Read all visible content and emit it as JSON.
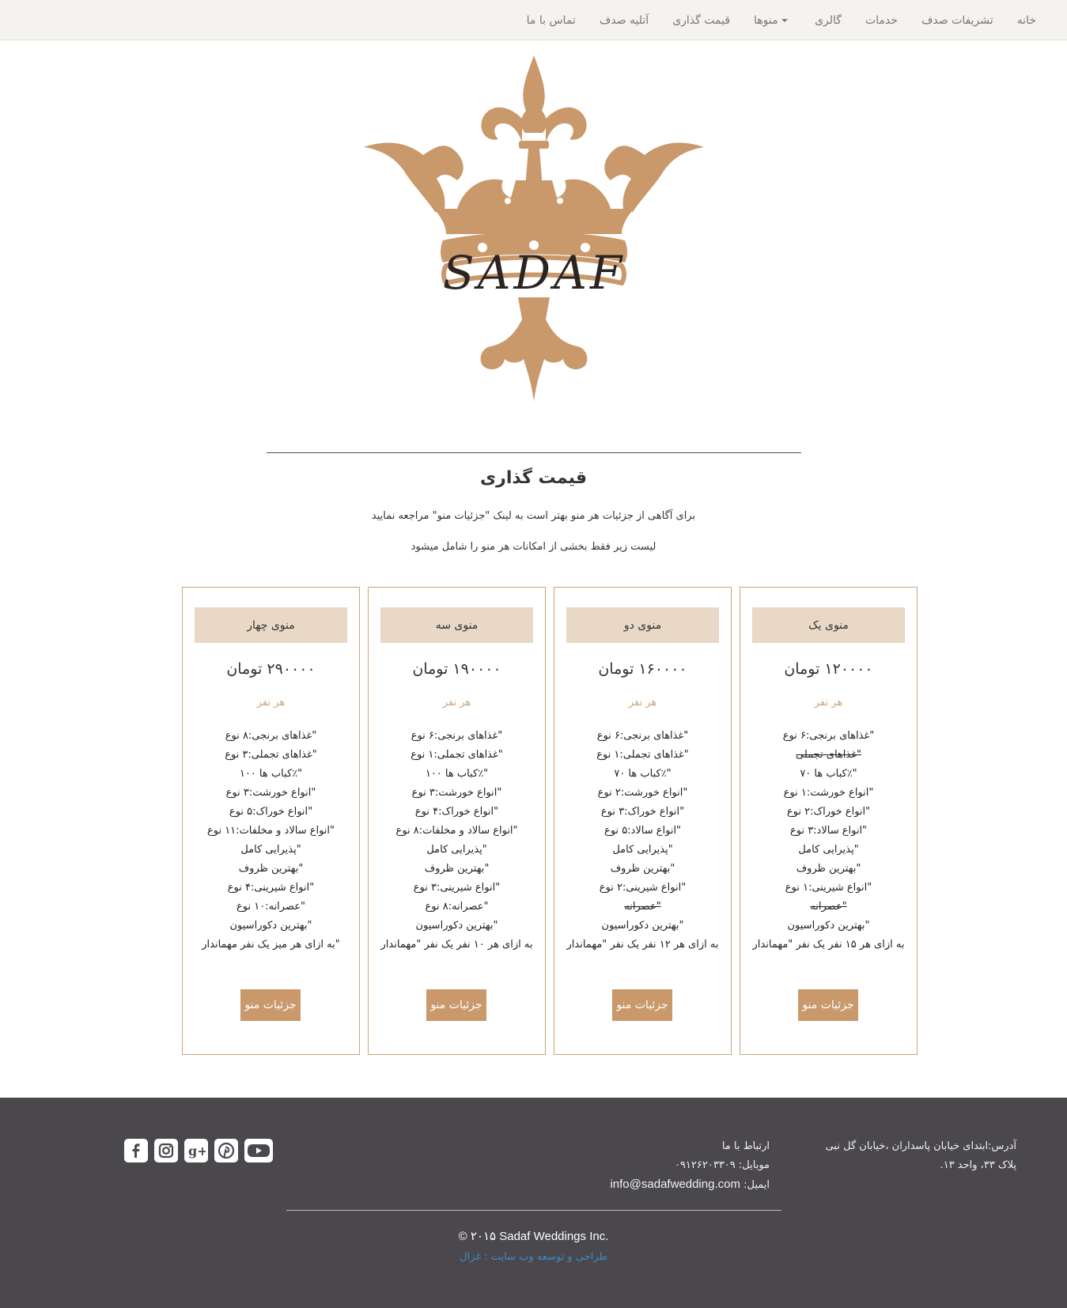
{
  "nav": {
    "items": [
      "خانه",
      "تشریفات صدف",
      "خدمات",
      "گالری",
      "منوها",
      "قیمت گذاری",
      "آتلیه صدف",
      "تماس با ما"
    ]
  },
  "logo": {
    "text": "SADAF"
  },
  "pricing": {
    "title": "قیمت گذاری",
    "intro_1": "برای آگاهی از جزئیات هر منو بهتر است به لینک \"جزئیات منو\" مراجعه نمایید",
    "intro_2": "لیست زیر فقط بخشی از امکانات هر منو را شامل میشود",
    "per_person": "هر نفر",
    "button_label": "جزئیات منو",
    "cards": [
      {
        "title": "منوی یک",
        "price": "۱۲۰۰۰۰ تومان",
        "features": [
          {
            "text": "\"غذاهای برنجی:۶ نوع",
            "struck": false
          },
          {
            "text": "\"غذاهای تجملی",
            "struck": true
          },
          {
            "text": "\"٪کباب ها ۷۰",
            "struck": false
          },
          {
            "text": "\"انواع خورشت:۱ نوع",
            "struck": false
          },
          {
            "text": "\"انواع خوراک:۲ نوع",
            "struck": false
          },
          {
            "text": "\"انواع سالاد:۳ نوع",
            "struck": false
          },
          {
            "text": "\"پذیرایی کامل",
            "struck": false
          },
          {
            "text": "\"بهترین ظروف",
            "struck": false
          },
          {
            "text": "\"انواع شیرینی:۱ نوع",
            "struck": false
          },
          {
            "text": "\"عصرانه",
            "struck": true
          },
          {
            "text": "\"بهترین دکوراسیون",
            "struck": false
          },
          {
            "text": "به ازای هر ۱۵ نفر یک نفر \"مهماندار",
            "struck": false
          }
        ]
      },
      {
        "title": "منوی دو",
        "price": "۱۶۰۰۰۰ تومان",
        "features": [
          {
            "text": "\"غذاهای برنجی:۶ نوع",
            "struck": false
          },
          {
            "text": "\"غذاهای تجملی:۱ نوع",
            "struck": false
          },
          {
            "text": "\"٪کباب ها ۷۰",
            "struck": false
          },
          {
            "text": "\"انواع خورشت:۲ نوع",
            "struck": false
          },
          {
            "text": "\"انواع خوراک:۳ نوع",
            "struck": false
          },
          {
            "text": "\"انواع سالاد:۵ نوع",
            "struck": false
          },
          {
            "text": "\"پذیرایی کامل",
            "struck": false
          },
          {
            "text": "\"بهترین ظروف",
            "struck": false
          },
          {
            "text": "\"انواع شیرینی:۲ نوع",
            "struck": false
          },
          {
            "text": "\"عصرانه",
            "struck": true
          },
          {
            "text": "\"بهترین دکوراسیون",
            "struck": false
          },
          {
            "text": "به ازای هر ۱۲ نفر یک نفر \"مهماندار",
            "struck": false
          }
        ]
      },
      {
        "title": "منوی سه",
        "price": "۱۹۰۰۰۰ تومان",
        "features": [
          {
            "text": "\"غذاهای برنجی:۶ نوع",
            "struck": false
          },
          {
            "text": "\"غذاهای تجملی:۱ نوع",
            "struck": false
          },
          {
            "text": "\"٪کباب ها ۱۰۰",
            "struck": false
          },
          {
            "text": "\"انواع خورشت:۳ نوع",
            "struck": false
          },
          {
            "text": "\"انواع خوراک:۴ نوع",
            "struck": false
          },
          {
            "text": "\"انواع سالاد و مخلفات:۸ نوع",
            "struck": false
          },
          {
            "text": "\"پذیرایی کامل",
            "struck": false
          },
          {
            "text": "\"بهترین ظروف",
            "struck": false
          },
          {
            "text": "\"انواع شیرینی:۳ نوع",
            "struck": false
          },
          {
            "text": "\"عصرانه:۸ نوع",
            "struck": false
          },
          {
            "text": "\"بهترین دکوراسیون",
            "struck": false
          },
          {
            "text": "به ازای هر ۱۰ نفر یک نفر \"مهماندار",
            "struck": false
          }
        ]
      },
      {
        "title": "منوی چهار",
        "price": "۲۹۰۰۰۰ تومان",
        "features": [
          {
            "text": "\"غذاهای برنجی:۸ نوع",
            "struck": false
          },
          {
            "text": "\"غذاهای تجملی:۳ نوع",
            "struck": false
          },
          {
            "text": "\"٪کباب ها ۱۰۰",
            "struck": false
          },
          {
            "text": "\"انواع خورشت:۳ نوع",
            "struck": false
          },
          {
            "text": "\"انواع خوراک:۵ نوع",
            "struck": false
          },
          {
            "text": "\"انواع سالاد و مخلفات:۱۱ نوع",
            "struck": false
          },
          {
            "text": "\"پذیرایی کامل",
            "struck": false
          },
          {
            "text": "\"بهترین ظروف",
            "struck": false
          },
          {
            "text": "\"انواع شیرینی:۴ نوع",
            "struck": false
          },
          {
            "text": "\"عصرانه:۱۰ نوع",
            "struck": false
          },
          {
            "text": "\"بهترین دکوراسیون",
            "struck": false
          },
          {
            "text": "\"به ازای هر میز یک نفر مهماندار",
            "struck": false
          }
        ]
      }
    ]
  },
  "footer": {
    "address_1": "آدرس:ابتدای خیابان پاسداران ،خیابان گل نبی",
    "address_2": "پلاک ۳۳، واحد ۱۳.",
    "contact_title": "ارتباط با ما",
    "mobile": "موبایل: ۰۹۱۲۶۲۰۳۳۰۹",
    "email_label": "ایمیل: ",
    "email": "info@sadafwedding.com",
    "copyright": "© ۲۰۱۵ Sadaf Weddings Inc.",
    "credit": "طراحی و توسعه وب سایت : غزال",
    "socials": [
      "youtube-icon",
      "pinterest-icon",
      "google-plus-icon",
      "instagram-icon",
      "facebook-icon"
    ]
  },
  "colors": {
    "accent": "#c9996b",
    "card_header": "#e8d8c5",
    "footer_bg": "#4a484d",
    "logo_gold": "#c9996b",
    "logo_text": "#2b2420"
  }
}
